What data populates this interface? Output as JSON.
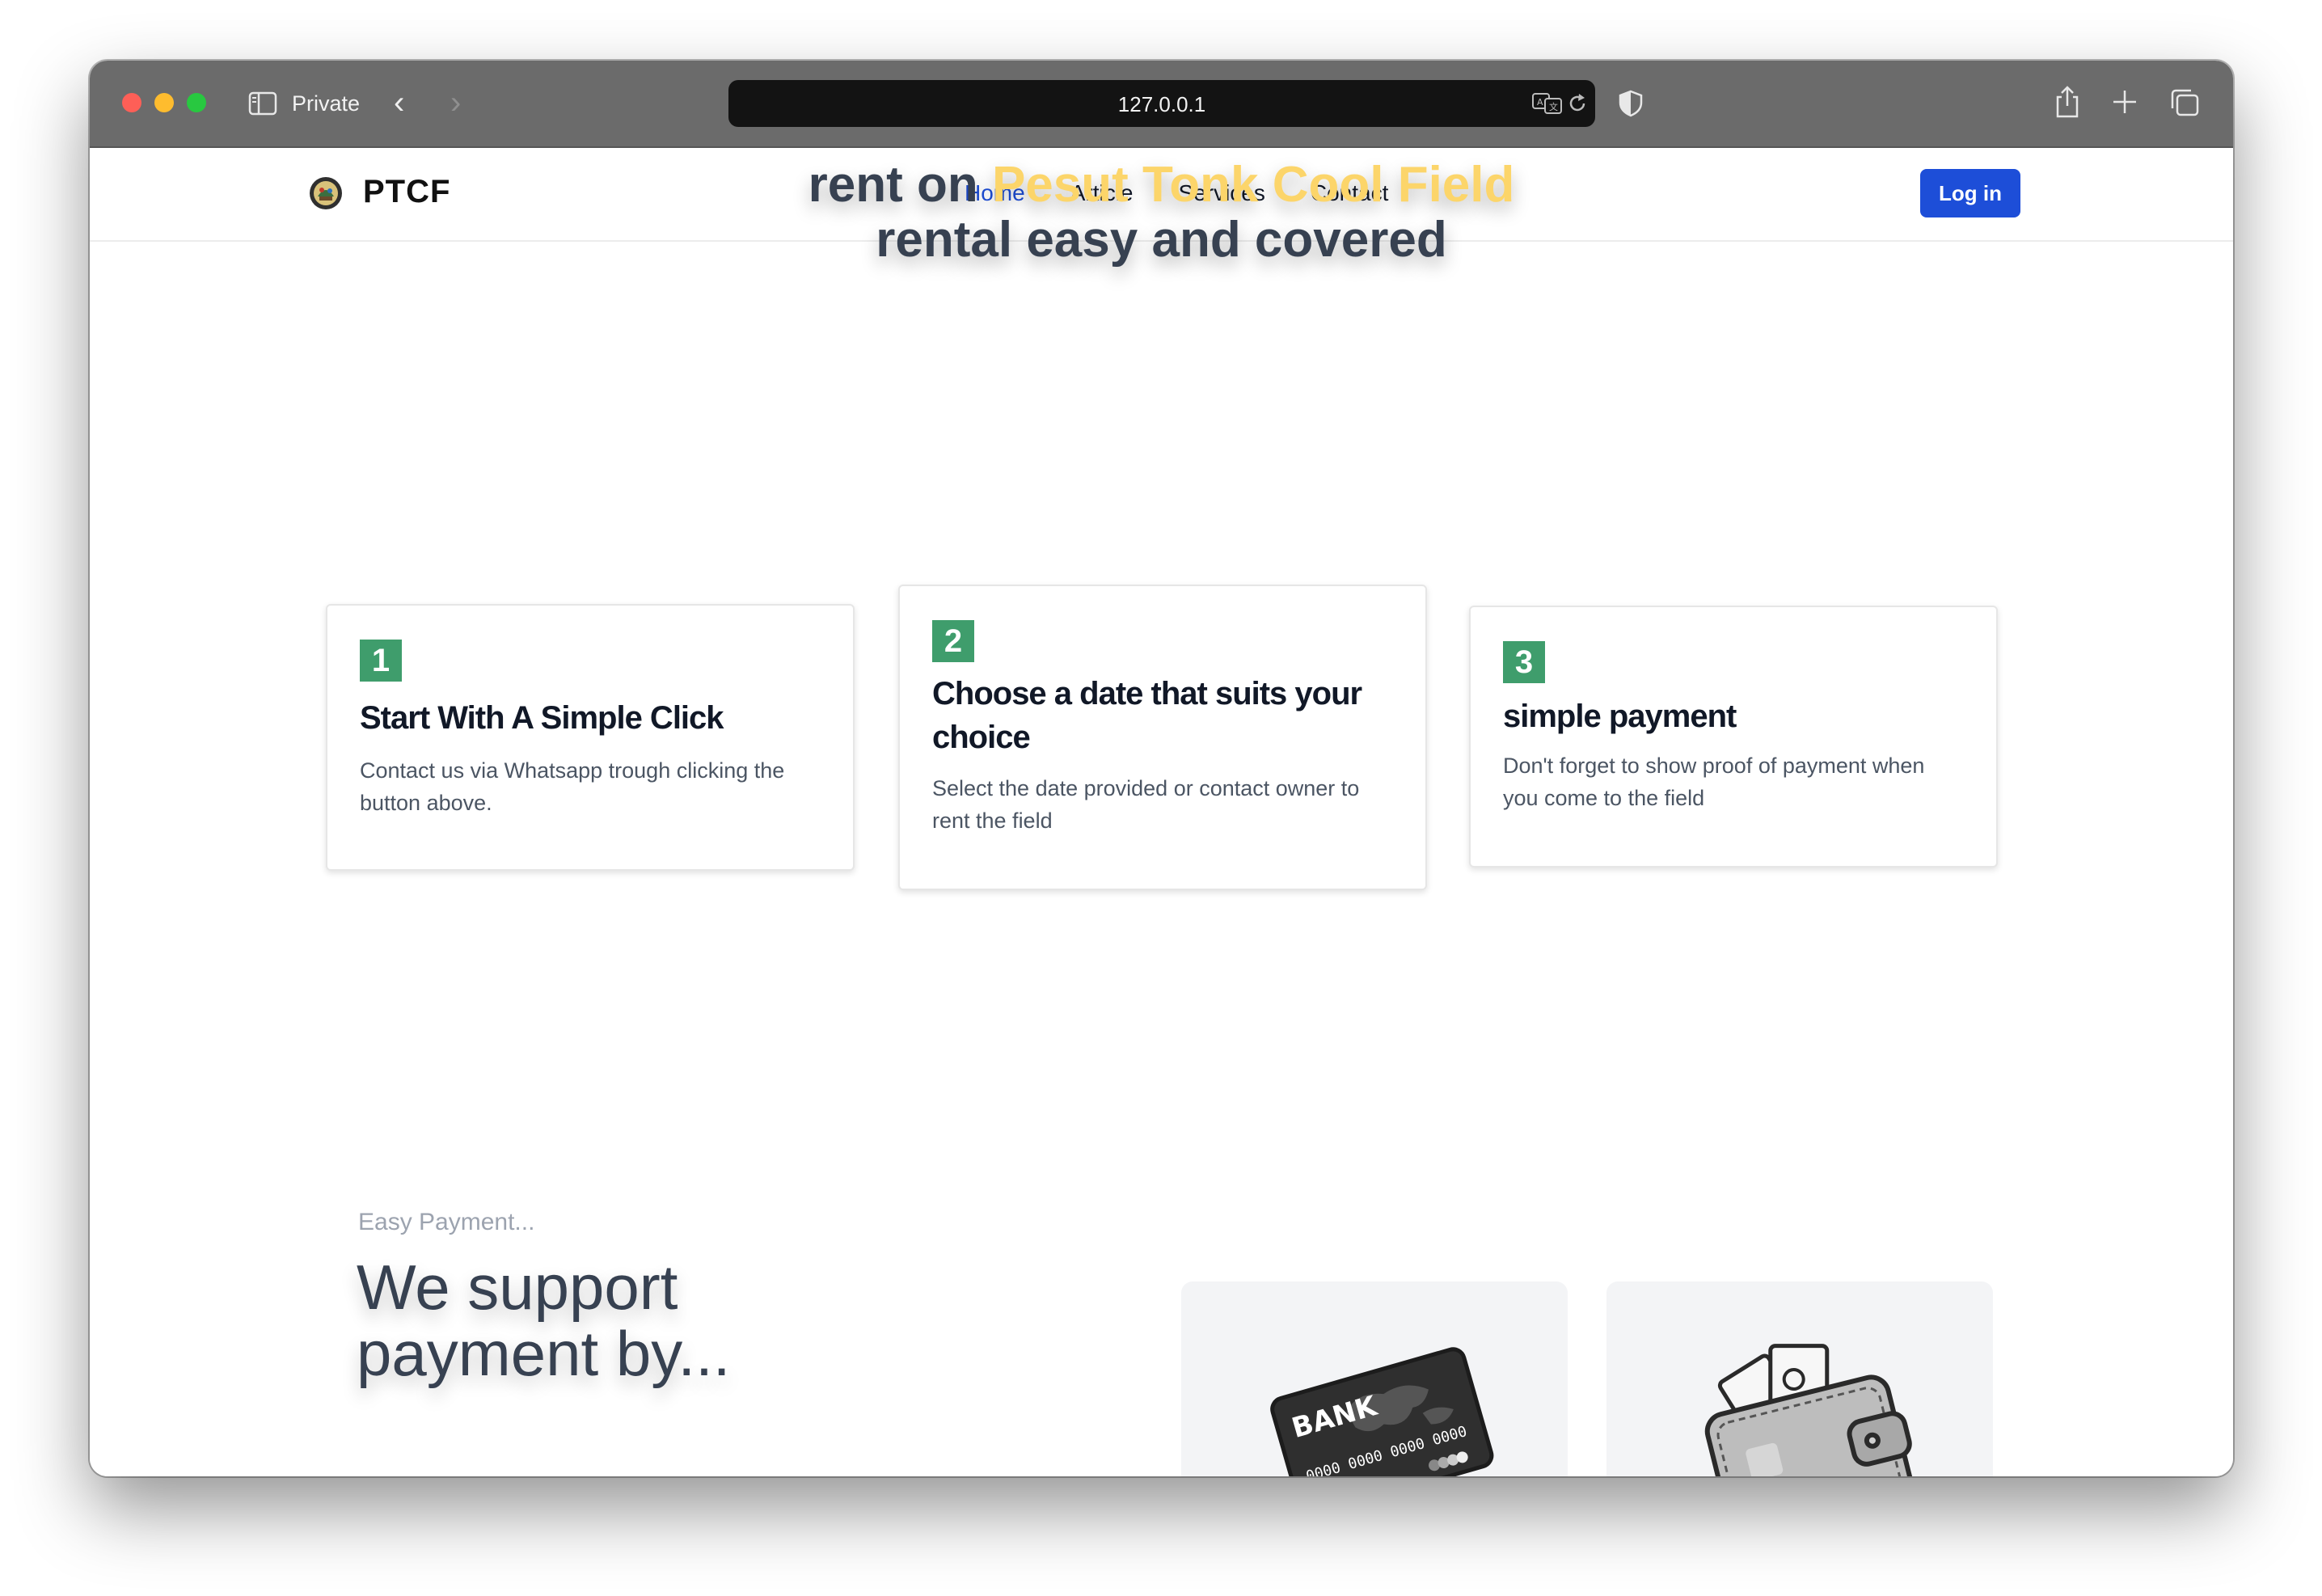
{
  "browser": {
    "private_label": "Private",
    "url": "127.0.0.1"
  },
  "navbar": {
    "brand": "PTCF",
    "links": [
      {
        "label": "Home",
        "active": true
      },
      {
        "label": "Article",
        "active": false
      },
      {
        "label": "Services",
        "active": false
      },
      {
        "label": "Contact",
        "active": false
      }
    ],
    "login_label": "Log in"
  },
  "hero": {
    "line1_prefix": "rent on",
    "line1_highlight": "Pesut Tonk Cool Field",
    "line2": "rental easy and covered",
    "highlight_color": "#fcd56a"
  },
  "steps": [
    {
      "number": "1",
      "title": "Start With A Simple Click",
      "description": "Contact us via Whatsapp trough clicking the button above."
    },
    {
      "number": "2",
      "title": "Choose a date that suits your choice",
      "description": "Select the date provided or contact owner to rent the field"
    },
    {
      "number": "3",
      "title": "simple payment",
      "description": "Don't forget to show proof of payment when you come to the field"
    }
  ],
  "payment": {
    "label": "Easy Payment...",
    "heading": "We support payment by...",
    "methods": [
      {
        "icon": "bank-card-icon",
        "card_text": "BANK",
        "card_number": "0000 0000 0000 0000"
      },
      {
        "icon": "wallet-icon"
      }
    ]
  },
  "colors": {
    "accent": "#1d4ed8",
    "step_badge": "#3f9d6c"
  }
}
